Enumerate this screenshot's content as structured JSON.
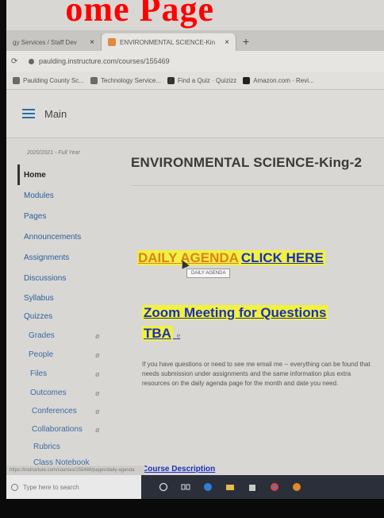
{
  "overlay": {
    "title": "ome Page"
  },
  "browser": {
    "tabs": [
      {
        "label": "gy Services / Staff Dev",
        "close": "×"
      },
      {
        "label": "ENVIRONMENTAL SCIENCE-Kin",
        "close": "×"
      }
    ],
    "new_tab": "+",
    "url": "paulding.instructure.com/courses/155469",
    "bookmarks": [
      "Paulding County Sc...",
      "Technology Service...",
      "Find a Quiz · Quizizz",
      "Amazon.com · Revi..."
    ]
  },
  "canvas": {
    "header_main": "Main",
    "term": "2020/2021 - Full Year",
    "nav": [
      {
        "label": "Home"
      },
      {
        "label": "Modules"
      },
      {
        "label": "Pages"
      },
      {
        "label": "Announcements"
      },
      {
        "label": "Assignments"
      },
      {
        "label": "Discussions"
      },
      {
        "label": "Syllabus"
      },
      {
        "label": "Quizzes"
      },
      {
        "label": "Grades"
      },
      {
        "label": "People"
      },
      {
        "label": "Files"
      },
      {
        "label": "Outcomes"
      },
      {
        "label": "Conferences"
      },
      {
        "label": "Collaborations"
      },
      {
        "label": "Rubrics"
      },
      {
        "label": "Class Notebook"
      }
    ],
    "page_title": "ENVIRONMENTAL SCIENCE-King-2",
    "agenda_part1": "DAILY AGENDA",
    "agenda_part2": "CLICK HERE",
    "tooltip": "DAILY AGENDA",
    "zoom_line1": "Zoom Meeting for Questions",
    "zoom_line2": "TBA",
    "zoom_suffix": "e",
    "body_text": "If you have questions or need to see me email me -- everything can be found that needs submission under assignments and the same information plus extra resources on the daily agenda page for the month and date you need.",
    "course_desc": "Course Description"
  },
  "status": {
    "url_hover": "https://instructure.com/courses/155469/pages/daily-agenda"
  },
  "taskbar": {
    "search_placeholder": "Type here to search"
  }
}
